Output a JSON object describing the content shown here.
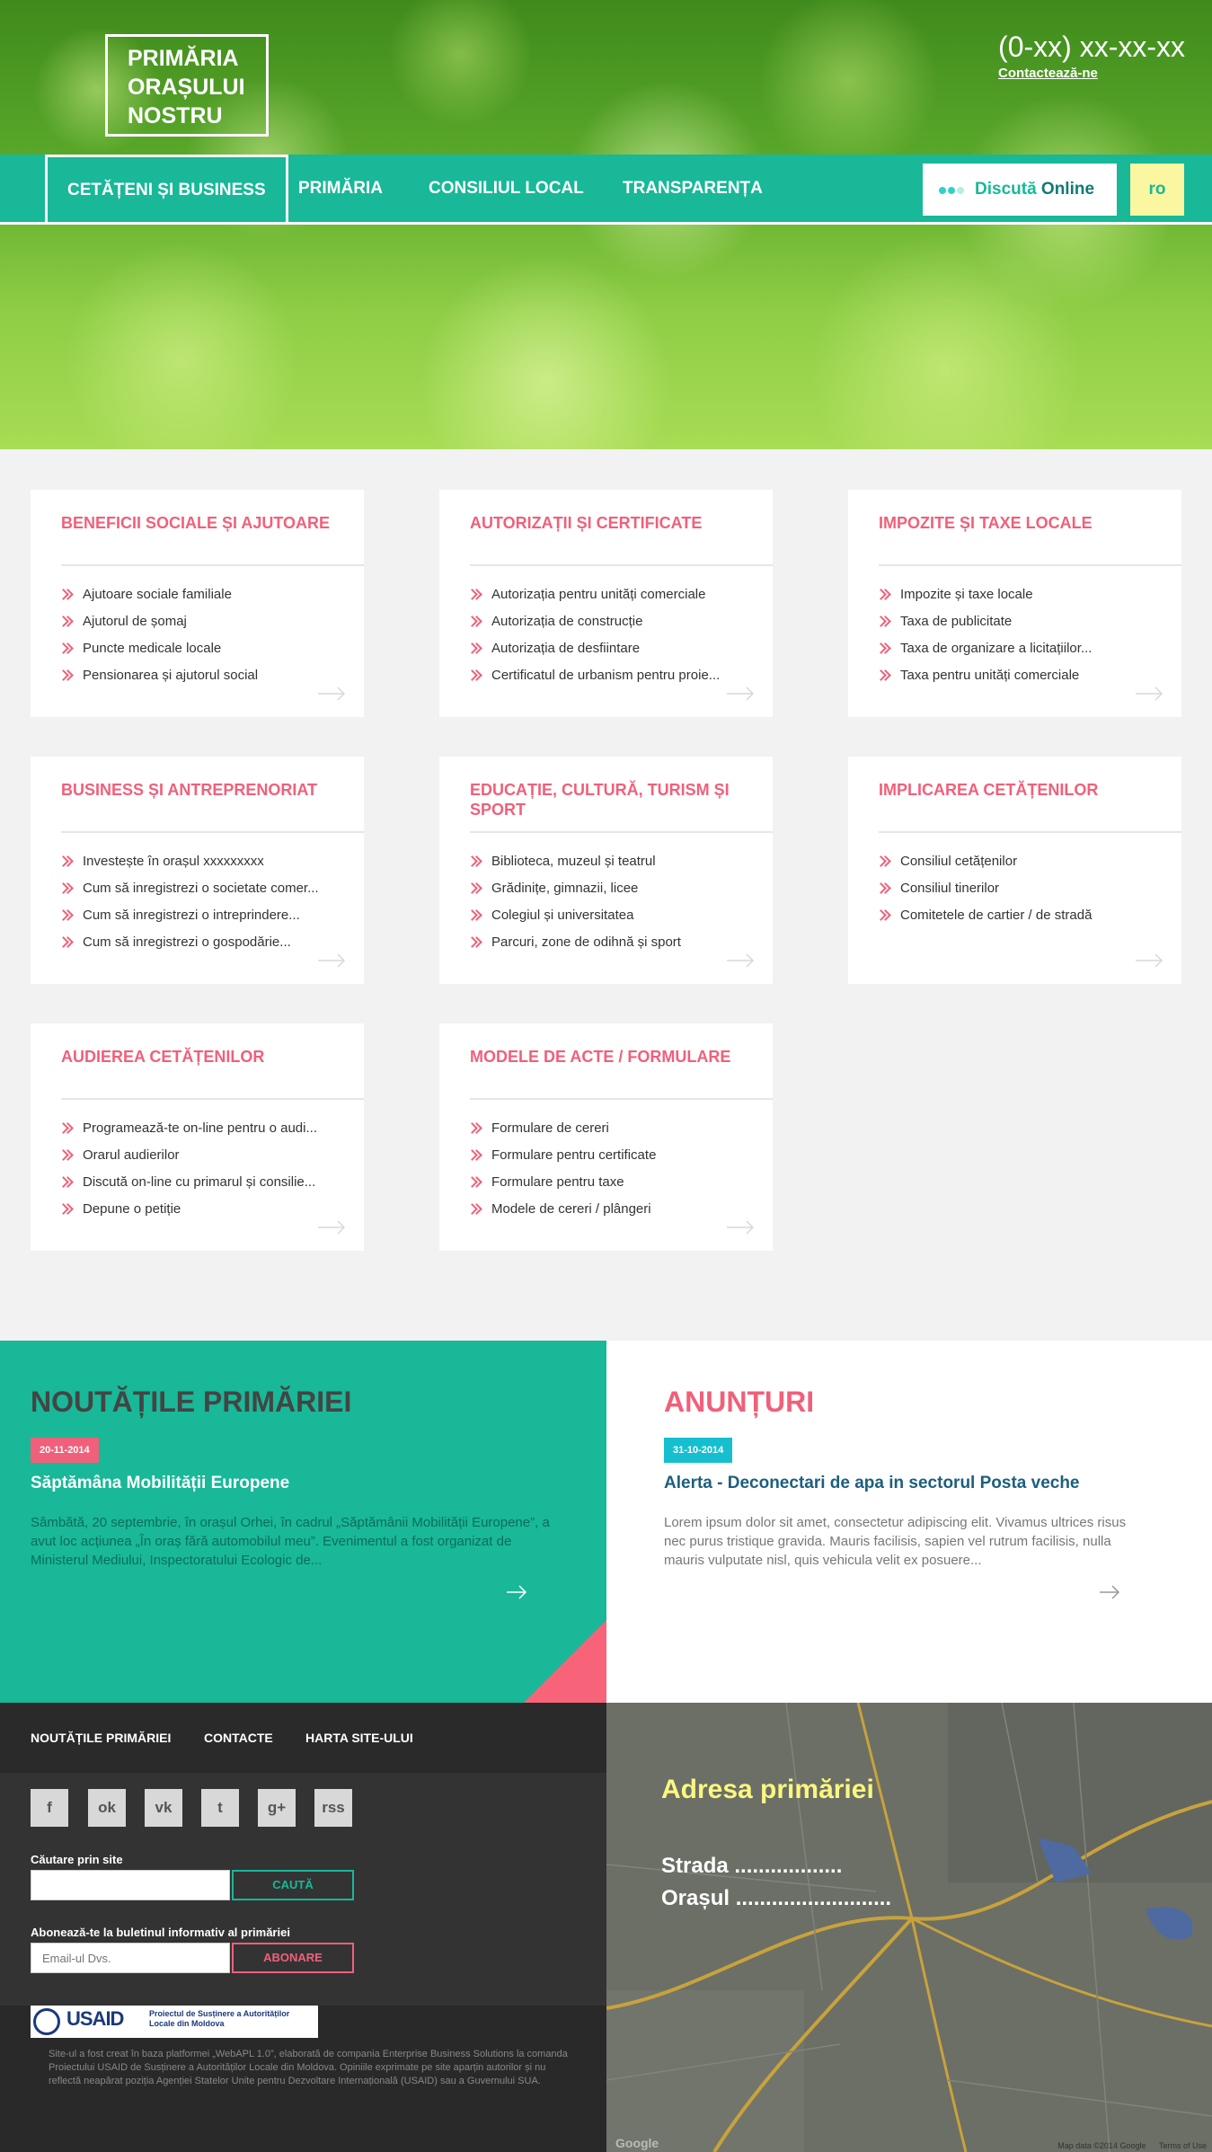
{
  "header": {
    "logo_lines": [
      "PRIMĂRIA",
      "ORAȘULUI",
      "NOSTRU"
    ],
    "phone": "(0-xx) xx-xx-xx",
    "contact_link": "Contactează-ne"
  },
  "nav": {
    "items": [
      "CETĂȚENI ȘI BUSINESS",
      "PRIMĂRIA",
      "CONSILIUL LOCAL",
      "TRANSPARENȚA"
    ],
    "chat_label_1": "Discută",
    "chat_label_2": "Online",
    "lang": "ro"
  },
  "cards": [
    {
      "title": "BENEFICII SOCIALE ȘI AJUTOARE",
      "items": [
        "Ajutoare sociale familiale",
        "Ajutorul de șomaj",
        "Puncte medicale locale",
        "Pensionarea și ajutorul social"
      ]
    },
    {
      "title": "AUTORIZAȚII ȘI CERTIFICATE",
      "items": [
        "Autorizația pentru unități comerciale",
        "Autorizația de construcție",
        "Autorizația de desfiintare",
        "Certificatul de urbanism pentru proie..."
      ]
    },
    {
      "title": "IMPOZITE ȘI TAXE LOCALE",
      "items": [
        "Impozite și taxe locale",
        "Taxa de publicitate",
        "Taxa de organizare a licitațiilor...",
        "Taxa pentru unități comerciale"
      ]
    },
    {
      "title": "BUSINESS ȘI ANTREPRENORIAT",
      "items": [
        "Investește în orașul xxxxxxxxx",
        "Cum să inregistrezi o societate comer...",
        "Cum să inregistrezi o intreprindere...",
        "Cum să inregistrezi o gospodărie..."
      ]
    },
    {
      "title": "EDUCAȚIE, CULTURĂ, TURISM ȘI SPORT",
      "items": [
        "Biblioteca, muzeul și teatrul",
        "Grădinițe, gimnazii, licee",
        "Colegiul și universitatea",
        "Parcuri, zone de odihnă și sport"
      ]
    },
    {
      "title": "IMPLICAREA CETĂȚENILOR",
      "items": [
        "Consiliul cetățenilor",
        "Consiliul tinerilor",
        "Comitetele de cartier / de stradă"
      ]
    },
    {
      "title": "AUDIEREA CETĂȚENILOR",
      "items": [
        "Programează-te on-line pentru o audi...",
        "Orarul audierilor",
        "Discută on-line cu primarul și consilie...",
        "Depune o petiție"
      ]
    },
    {
      "title": "MODELE DE ACTE / FORMULARE",
      "items": [
        "Formulare de cereri",
        "Formulare pentru certificate",
        "Formulare pentru taxe",
        "Modele de cereri / plângeri"
      ]
    }
  ],
  "news": {
    "title": "NOUTĂȚILE PRIMĂRIEI",
    "date": "20-11-2014",
    "headline": "Săptămâna Mobilității Europene",
    "excerpt": "Sâmbătă, 20 septembrie, în orașul Orhei, în cadrul „Săptămânii Mobilității Europene”, a avut loc acțiunea „În oraș fără automobilul meu”. Evenimentul a fost organizat de Ministerul Mediului, Inspectoratului Ecologic de..."
  },
  "announcements": {
    "title": "ANUNȚURI",
    "date": "31-10-2014",
    "headline": "Alerta - Deconectari de apa in sectorul Posta veche",
    "excerpt": "Lorem ipsum dolor sit amet, consectetur adipiscing elit. Vivamus ultrices risus nec purus tristique gravida. Mauris facilisis, sapien vel rutrum facilisis, nulla mauris vulputate nisl, quis vehicula velit ex posuere..."
  },
  "footer": {
    "nav": [
      "NOUTĂȚILE PRIMĂRIEI",
      "CONTACTE",
      "HARTA SITE-ULUI"
    ],
    "social_icons": [
      "facebook-icon",
      "odnoklassniki-icon",
      "vk-icon",
      "twitter-icon",
      "googleplus-icon",
      "rss-icon"
    ],
    "social_glyphs": [
      "f",
      "ok",
      "vk",
      "t",
      "g+",
      "rss"
    ],
    "search_label": "Căutare prin site",
    "search_placeholder": "",
    "search_button": "CAUTĂ",
    "subscribe_label": "Abonează-te la buletinul informativ al primăriei",
    "subscribe_placeholder": "Email-ul Dvs.",
    "subscribe_button": "ABONARE",
    "usaid_text": "USAID",
    "usaid_project": "Proiectul de Susținere a Autorităților Locale din Moldova",
    "disclaimer": "Site-ul a fost creat în baza platformei „WebAPL 1.0”, elaborată de compania Enterprise Business Solutions la comanda Proiectului USAID de Susținere a Autorităților Locale din Moldova. Opiniile exprimate pe site aparțin autorilor și nu reflectă neapărat poziția Agenției Statelor Unite pentru Dezvoltare Internațională (USAID) sau a Guvernului SUA."
  },
  "map": {
    "title": "Adresa primăriei",
    "street": "Strada ..................",
    "city": "Orașul ..........................",
    "credit_data": "Map data ©2014 Google",
    "credit_terms": "Terms of Use",
    "google": "Google"
  },
  "colors": {
    "teal": "#18b898",
    "pink": "#f0607a",
    "yellow": "#fbf7a0",
    "dark": "#333333"
  }
}
